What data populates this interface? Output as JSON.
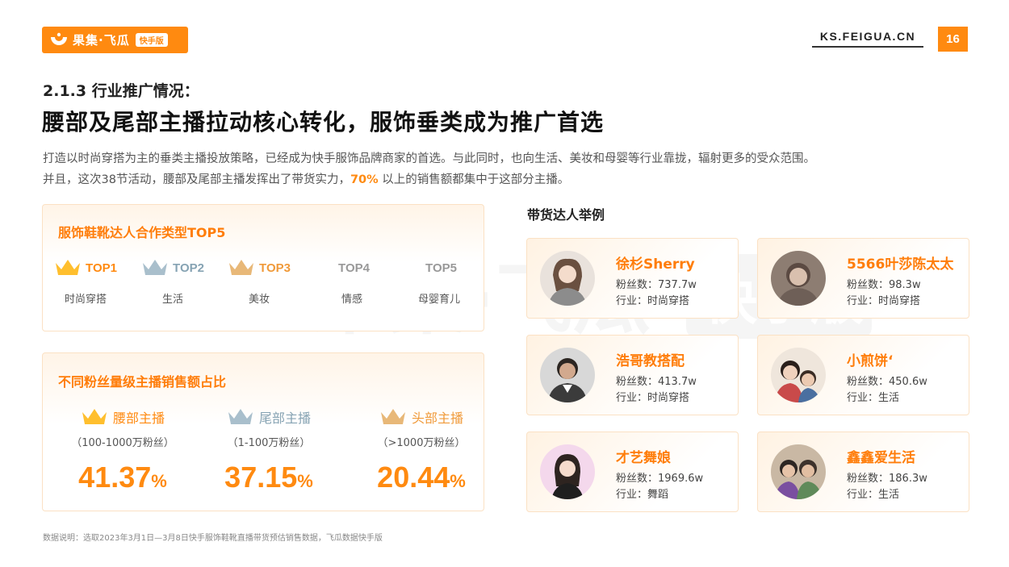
{
  "header": {
    "logo_brand": "果集·飞瓜",
    "logo_edition": "快手版",
    "site": "KS.FEIGUA.CN",
    "page_number": "16",
    "accent_color": "#ff8a10"
  },
  "section_label": "2.1.3 行业推广情况：",
  "title": "腰部及尾部主播拉动核心转化，服饰垂类成为推广首选",
  "description": {
    "line1": "打造以时尚穿搭为主的垂类主播投放策略，已经成为快手服饰品牌商家的首选。与此同时，也向生活、美妆和母婴等行业靠拢，辐射更多的受众范围。",
    "line2_before": "并且，这次38节活动，腰部及尾部主播发挥出了带货实力，",
    "line2_highlight": "70%",
    "line2_after": " 以上的销售额都集中于这部分主播。"
  },
  "top5_card": {
    "title": "服饰鞋靴达人合作类型TOP5",
    "ranks": [
      {
        "rank": "TOP1",
        "label": "时尚穿搭",
        "icon": "crown-icon",
        "color": "#ffbf2e",
        "text_color": "#ff8a10"
      },
      {
        "rank": "TOP2",
        "label": "生活",
        "icon": "crown-icon",
        "color": "#a9bfcc",
        "text_color": "#86a3b3"
      },
      {
        "rank": "TOP3",
        "label": "美妆",
        "icon": "crown-icon",
        "color": "#e8b878",
        "text_color": "#f09a3a"
      },
      {
        "rank": "TOP4",
        "label": "情感",
        "icon": "",
        "color": "",
        "text_color": "#999999"
      },
      {
        "rank": "TOP5",
        "label": "母婴育儿",
        "icon": "",
        "color": "",
        "text_color": "#999999"
      }
    ]
  },
  "share_card": {
    "title": "不同粉丝量级主播销售额占比",
    "segments": [
      {
        "name": "腰部主播",
        "range": "（100-1000万粉丝）",
        "value": "41.37",
        "unit": "%",
        "icon": "crown-icon",
        "color": "#ffbf2e",
        "name_color": "#ff8a10"
      },
      {
        "name": "尾部主播",
        "range": "（1-100万粉丝）",
        "value": "37.15",
        "unit": "%",
        "icon": "crown-icon",
        "color": "#a9bfcc",
        "name_color": "#86a3b3"
      },
      {
        "name": "头部主播",
        "range": "（>1000万粉丝）",
        "value": "20.44",
        "unit": "%",
        "icon": "crown-icon",
        "color": "#e8b878",
        "name_color": "#f09a3a"
      }
    ]
  },
  "examples": {
    "title": "带货达人举例",
    "items": [
      {
        "name": "徐杉Sherry",
        "fans": "粉丝数：737.7w",
        "industry": "行业：时尚穿搭"
      },
      {
        "name": "5566叶莎陈太太",
        "fans": "粉丝数：98.3w",
        "industry": "行业：时尚穿搭"
      },
      {
        "name": "浩哥教搭配",
        "fans": "粉丝数：413.7w",
        "industry": " 行业：时尚穿搭"
      },
      {
        "name": "小煎饼‘",
        "fans": "粉丝数：450.6w",
        "industry": "行业：生活"
      },
      {
        "name": "才艺舞娘",
        "fans": "粉丝数：1969.6w",
        "industry": "行业：舞蹈"
      },
      {
        "name": "鑫鑫爱生活",
        "fans": "粉丝数：186.3w",
        "industry": "行业：生活"
      }
    ]
  },
  "footnote": "数据说明：选取2023年3月1日—3月8日快手服饰鞋靴直播带货预估销售数据，飞瓜数据快手版"
}
